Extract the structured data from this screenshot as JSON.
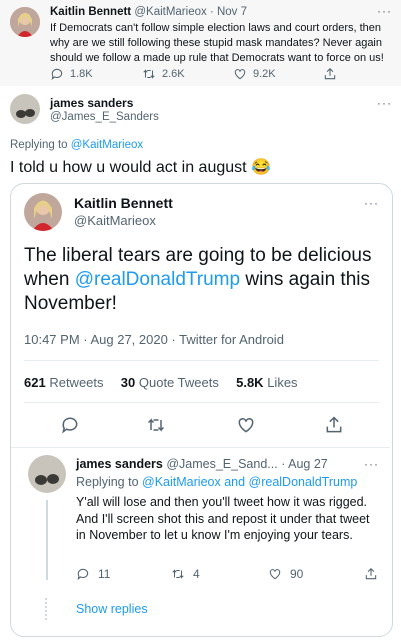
{
  "tweet1": {
    "name": "Kaitlin Bennett",
    "handle": "@KaitMarieox",
    "date": "· Nov 7",
    "text": "If Democrats can't follow simple election laws and court orders, then why are we still following these stupid mask mandates? Never again should we follow a made up rule that Democrats want to force on us!",
    "replies": "1.8K",
    "retweets": "2.6K",
    "likes": "9.2K"
  },
  "tweet2": {
    "name": "james sanders",
    "handle": "@James_E_Sanders",
    "replying_prefix": "Replying to",
    "replying_to": "@KaitMarieox",
    "text": "I told u how u would act in august",
    "emoji": "😂"
  },
  "quoted": {
    "name": "Kaitlin Bennett",
    "handle": "@KaitMarieox",
    "text_a": "The liberal tears are going to be delicious when ",
    "mention": "@realDonaldTrump",
    "text_b": " wins again this November!",
    "timestamp": "10:47 PM · Aug 27, 2020 · ",
    "client": "Twitter for Android",
    "retweets_count": "621",
    "retweets_label": "Retweets",
    "quotes_count": "30",
    "quotes_label": "Quote Tweets",
    "likes_count": "5.8K",
    "likes_label": "Likes"
  },
  "reply": {
    "name": "james sanders",
    "handle": "@James_E_Sand...",
    "date": "· Aug 27",
    "replying_prefix": "Replying to",
    "replying_to": "@KaitMarieox and @realDonaldTrump",
    "text": "Y'all will lose and then you'll tweet how it was rigged. And I'll screen shot this and repost it under that tweet in November to let u know I'm enjoying your tears.",
    "replies": "11",
    "retweets": "4",
    "likes": "90",
    "show_replies": "Show replies"
  },
  "colors": {
    "accent": "#1d9bf0",
    "muted": "#536471",
    "border": "#cfd9de"
  }
}
